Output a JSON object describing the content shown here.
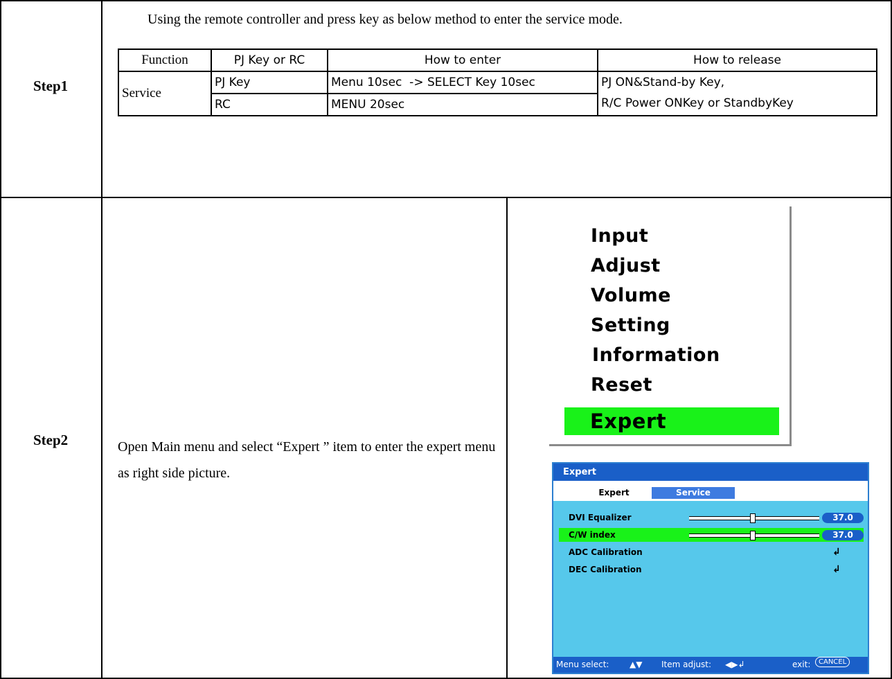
{
  "step1": {
    "label": "Step1",
    "intro": "Using the remote controller and press key as below method to enter the service mode.",
    "table": {
      "headers": [
        "Function",
        "PJ Key or RC",
        "How to enter",
        "How to release"
      ],
      "function": "Service",
      "rows": [
        {
          "key": "PJ Key",
          "enter": "Menu 10sec  -> SELECT Key 10sec"
        },
        {
          "key": "RC",
          "enter": "MENU 20sec"
        }
      ],
      "release_line1": "PJ ON&Stand-by Key,",
      "release_line2": "R/C Power ONKey or StandbyKey"
    }
  },
  "step2": {
    "label": "Step2",
    "text": "Open Main menu and select “Expert ” item to enter the expert menu as right side picture.",
    "main_menu": {
      "items": [
        "Input",
        "Adjust",
        "Volume",
        "Setting",
        "Information",
        "Reset"
      ],
      "selected": "Expert",
      "selected_color": "#19f219"
    },
    "expert_window": {
      "title": "Expert",
      "tabs": [
        "Expert",
        "Service"
      ],
      "active_tab": "Service",
      "rows": [
        {
          "label": "DVI Equalizer",
          "value": "37.0"
        },
        {
          "label": "C/W index",
          "value": "37.0"
        },
        {
          "label": "ADC Calibration",
          "icon": "enter-icon"
        },
        {
          "label": "DEC Calibration",
          "icon": "enter-icon"
        }
      ],
      "footer": {
        "menu_select": "Menu select:",
        "item_adjust": "Item adjust:",
        "exit": "exit:",
        "cancel_key": "CANCEL"
      },
      "colors": {
        "background": "#56c8eb",
        "title_bar": "#1a5fc8",
        "highlight": "#19f219"
      }
    }
  }
}
